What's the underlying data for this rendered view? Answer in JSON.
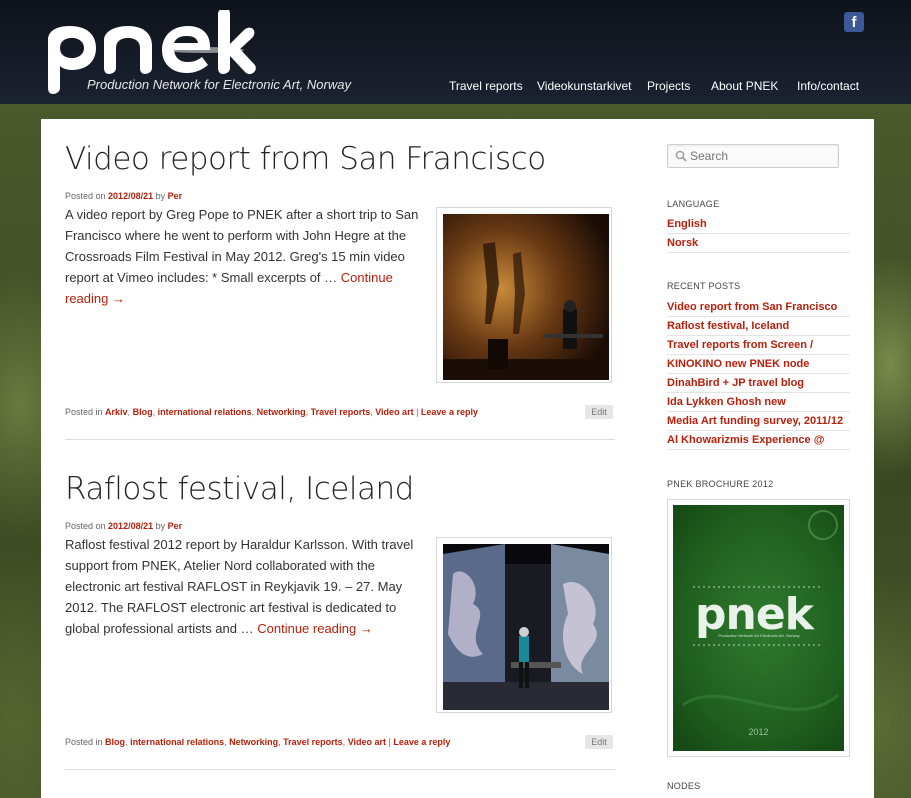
{
  "header": {
    "logo_text": "pnek",
    "tagline": "Production Network for Electronic Art, Norway",
    "facebook_label": "f",
    "nav": [
      "Travel reports",
      "Videokunstarkivet",
      "Projects",
      "About PNEK",
      "Info/contact"
    ]
  },
  "posts": [
    {
      "title": "Video report from San Francisco",
      "posted_on_label": "Posted on",
      "date": "2012/08/21",
      "by_label": "by",
      "author": "Per",
      "excerpt": "A video report by Greg Pope to PNEK after a short trip to San Francisco where he went to perform with John Hegre at the Crossroads Film Festival in May 2012. Greg's 15 min video report at Vimeo includes: * Small excerpts of …",
      "more": "Continue reading →",
      "posted_in_label": "Posted in",
      "categories": [
        "Arkiv",
        "Blog",
        "international relations",
        "Networking",
        "Travel reports",
        "Video art"
      ],
      "reply": "Leave a reply",
      "edit": "Edit"
    },
    {
      "title": "Raflost festival, Iceland",
      "posted_on_label": "Posted on",
      "date": "2012/08/21",
      "by_label": "by",
      "author": "Per",
      "excerpt": "Raflost festival 2012 report by Haraldur Karlsson. With travel support from PNEK, Atelier Nord collaborated with the electronic art festival RAFLOST in Reykjavik 19. – 27. May 2012. The RAFLOST electronic art festival is dedicated to global professional artists and …",
      "more": "Continue reading →",
      "posted_in_label": "Posted in",
      "categories": [
        "Blog",
        "international relations",
        "Networking",
        "Travel reports",
        "Video art"
      ],
      "reply": "Leave a reply",
      "edit": "Edit"
    }
  ],
  "sidebar": {
    "search_placeholder": "Search",
    "language_title": "LANGUAGE",
    "languages": [
      "English",
      "Norsk"
    ],
    "recent_title": "RECENT POSTS",
    "recent_posts": [
      "Video report from San Francisco",
      "Raflost festival, Iceland",
      "Travel reports from Screen /",
      "KINOKINO new PNEK node",
      "DinahBird + JP travel blog",
      "Ida Lykken Ghosh new",
      "Media Art funding survey, 2011/12",
      "Al Khowarizmis Experience @"
    ],
    "brochure_title": "PNEK BROCHURE 2012",
    "brochure_logo": "pnek",
    "brochure_tagline": "Production Network for Electronic Art, Norway",
    "brochure_year": "2012",
    "nodes_title": "NODES"
  },
  "colors": {
    "link": "#b8200c",
    "header": "#141a24",
    "brochure_green": "#1e5e1e"
  }
}
